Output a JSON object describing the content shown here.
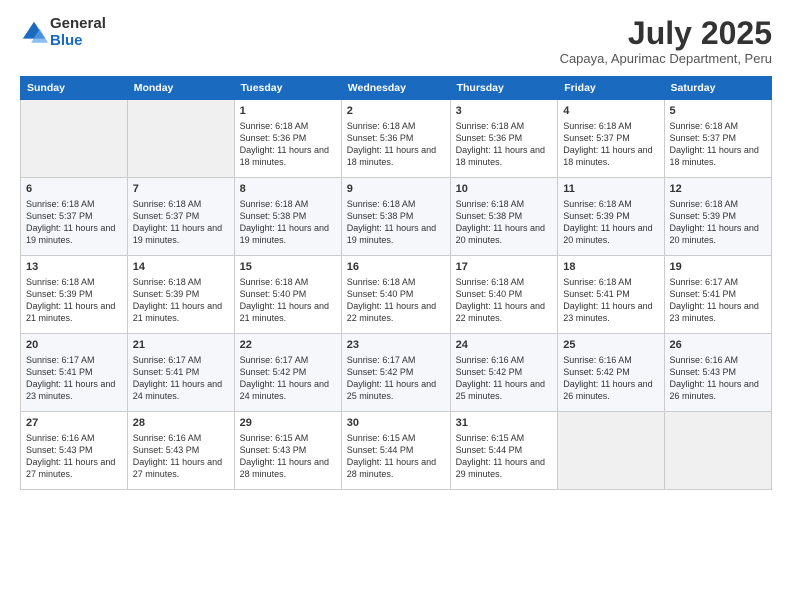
{
  "header": {
    "logo_general": "General",
    "logo_blue": "Blue",
    "month_title": "July 2025",
    "location": "Capaya, Apurimac Department, Peru"
  },
  "days_of_week": [
    "Sunday",
    "Monday",
    "Tuesday",
    "Wednesday",
    "Thursday",
    "Friday",
    "Saturday"
  ],
  "weeks": [
    [
      {
        "day": "",
        "info": ""
      },
      {
        "day": "",
        "info": ""
      },
      {
        "day": "1",
        "info": "Sunrise: 6:18 AM\nSunset: 5:36 PM\nDaylight: 11 hours and 18 minutes."
      },
      {
        "day": "2",
        "info": "Sunrise: 6:18 AM\nSunset: 5:36 PM\nDaylight: 11 hours and 18 minutes."
      },
      {
        "day": "3",
        "info": "Sunrise: 6:18 AM\nSunset: 5:36 PM\nDaylight: 11 hours and 18 minutes."
      },
      {
        "day": "4",
        "info": "Sunrise: 6:18 AM\nSunset: 5:37 PM\nDaylight: 11 hours and 18 minutes."
      },
      {
        "day": "5",
        "info": "Sunrise: 6:18 AM\nSunset: 5:37 PM\nDaylight: 11 hours and 18 minutes."
      }
    ],
    [
      {
        "day": "6",
        "info": "Sunrise: 6:18 AM\nSunset: 5:37 PM\nDaylight: 11 hours and 19 minutes."
      },
      {
        "day": "7",
        "info": "Sunrise: 6:18 AM\nSunset: 5:37 PM\nDaylight: 11 hours and 19 minutes."
      },
      {
        "day": "8",
        "info": "Sunrise: 6:18 AM\nSunset: 5:38 PM\nDaylight: 11 hours and 19 minutes."
      },
      {
        "day": "9",
        "info": "Sunrise: 6:18 AM\nSunset: 5:38 PM\nDaylight: 11 hours and 19 minutes."
      },
      {
        "day": "10",
        "info": "Sunrise: 6:18 AM\nSunset: 5:38 PM\nDaylight: 11 hours and 20 minutes."
      },
      {
        "day": "11",
        "info": "Sunrise: 6:18 AM\nSunset: 5:39 PM\nDaylight: 11 hours and 20 minutes."
      },
      {
        "day": "12",
        "info": "Sunrise: 6:18 AM\nSunset: 5:39 PM\nDaylight: 11 hours and 20 minutes."
      }
    ],
    [
      {
        "day": "13",
        "info": "Sunrise: 6:18 AM\nSunset: 5:39 PM\nDaylight: 11 hours and 21 minutes."
      },
      {
        "day": "14",
        "info": "Sunrise: 6:18 AM\nSunset: 5:39 PM\nDaylight: 11 hours and 21 minutes."
      },
      {
        "day": "15",
        "info": "Sunrise: 6:18 AM\nSunset: 5:40 PM\nDaylight: 11 hours and 21 minutes."
      },
      {
        "day": "16",
        "info": "Sunrise: 6:18 AM\nSunset: 5:40 PM\nDaylight: 11 hours and 22 minutes."
      },
      {
        "day": "17",
        "info": "Sunrise: 6:18 AM\nSunset: 5:40 PM\nDaylight: 11 hours and 22 minutes."
      },
      {
        "day": "18",
        "info": "Sunrise: 6:18 AM\nSunset: 5:41 PM\nDaylight: 11 hours and 23 minutes."
      },
      {
        "day": "19",
        "info": "Sunrise: 6:17 AM\nSunset: 5:41 PM\nDaylight: 11 hours and 23 minutes."
      }
    ],
    [
      {
        "day": "20",
        "info": "Sunrise: 6:17 AM\nSunset: 5:41 PM\nDaylight: 11 hours and 23 minutes."
      },
      {
        "day": "21",
        "info": "Sunrise: 6:17 AM\nSunset: 5:41 PM\nDaylight: 11 hours and 24 minutes."
      },
      {
        "day": "22",
        "info": "Sunrise: 6:17 AM\nSunset: 5:42 PM\nDaylight: 11 hours and 24 minutes."
      },
      {
        "day": "23",
        "info": "Sunrise: 6:17 AM\nSunset: 5:42 PM\nDaylight: 11 hours and 25 minutes."
      },
      {
        "day": "24",
        "info": "Sunrise: 6:16 AM\nSunset: 5:42 PM\nDaylight: 11 hours and 25 minutes."
      },
      {
        "day": "25",
        "info": "Sunrise: 6:16 AM\nSunset: 5:42 PM\nDaylight: 11 hours and 26 minutes."
      },
      {
        "day": "26",
        "info": "Sunrise: 6:16 AM\nSunset: 5:43 PM\nDaylight: 11 hours and 26 minutes."
      }
    ],
    [
      {
        "day": "27",
        "info": "Sunrise: 6:16 AM\nSunset: 5:43 PM\nDaylight: 11 hours and 27 minutes."
      },
      {
        "day": "28",
        "info": "Sunrise: 6:16 AM\nSunset: 5:43 PM\nDaylight: 11 hours and 27 minutes."
      },
      {
        "day": "29",
        "info": "Sunrise: 6:15 AM\nSunset: 5:43 PM\nDaylight: 11 hours and 28 minutes."
      },
      {
        "day": "30",
        "info": "Sunrise: 6:15 AM\nSunset: 5:44 PM\nDaylight: 11 hours and 28 minutes."
      },
      {
        "day": "31",
        "info": "Sunrise: 6:15 AM\nSunset: 5:44 PM\nDaylight: 11 hours and 29 minutes."
      },
      {
        "day": "",
        "info": ""
      },
      {
        "day": "",
        "info": ""
      }
    ]
  ]
}
